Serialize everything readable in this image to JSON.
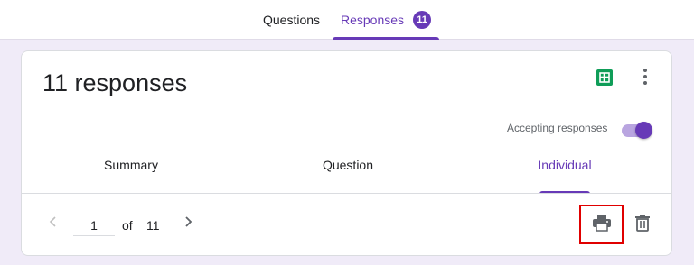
{
  "header": {
    "tabs": [
      {
        "label": "Questions",
        "active": false
      },
      {
        "label": "Responses",
        "active": true,
        "badge": "11"
      }
    ]
  },
  "card": {
    "title": "11 responses",
    "accepting": {
      "label": "Accepting responses",
      "on": true
    },
    "tabs": [
      {
        "label": "Summary",
        "active": false
      },
      {
        "label": "Question",
        "active": false
      },
      {
        "label": "Individual",
        "active": true
      }
    ],
    "pager": {
      "current": "1",
      "of_label": "of",
      "total": "11"
    },
    "icons": {
      "sheets": "google-sheets-icon",
      "more": "more-vert-icon",
      "prev": "chevron-left-icon",
      "next": "chevron-right-icon",
      "print": "print-icon",
      "delete": "trash-icon"
    }
  },
  "colors": {
    "accent": "#673ab7",
    "background": "#f0ebf8",
    "sheets": "#0f9d58",
    "highlight_box": "#e00000"
  }
}
